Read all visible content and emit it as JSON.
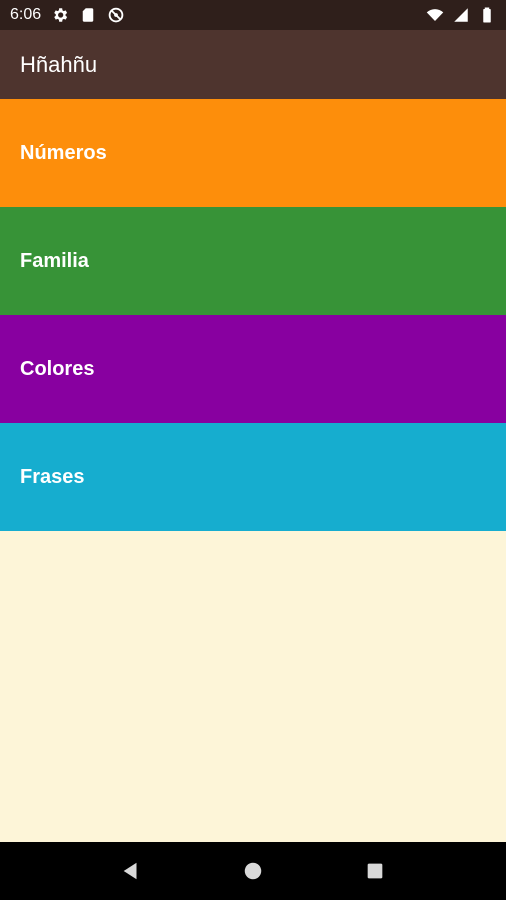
{
  "status_bar": {
    "time": "6:06",
    "left_icons": [
      "settings-icon",
      "sim-card-icon",
      "no-data-icon"
    ],
    "right_icons": [
      "wifi-icon",
      "cellular-icon",
      "battery-icon"
    ]
  },
  "app_bar": {
    "title": "Hñahñu",
    "background": "#4e342e"
  },
  "categories": [
    {
      "label": "Números",
      "color": "#fd8e0b"
    },
    {
      "label": "Familia",
      "color": "#379337"
    },
    {
      "label": "Colores",
      "color": "#8800a0"
    },
    {
      "label": "Frases",
      "color": "#16adcf"
    }
  ],
  "content_background": "#fdf5d8",
  "nav_bar": {
    "buttons": [
      "back-icon",
      "home-icon",
      "recents-icon"
    ]
  }
}
